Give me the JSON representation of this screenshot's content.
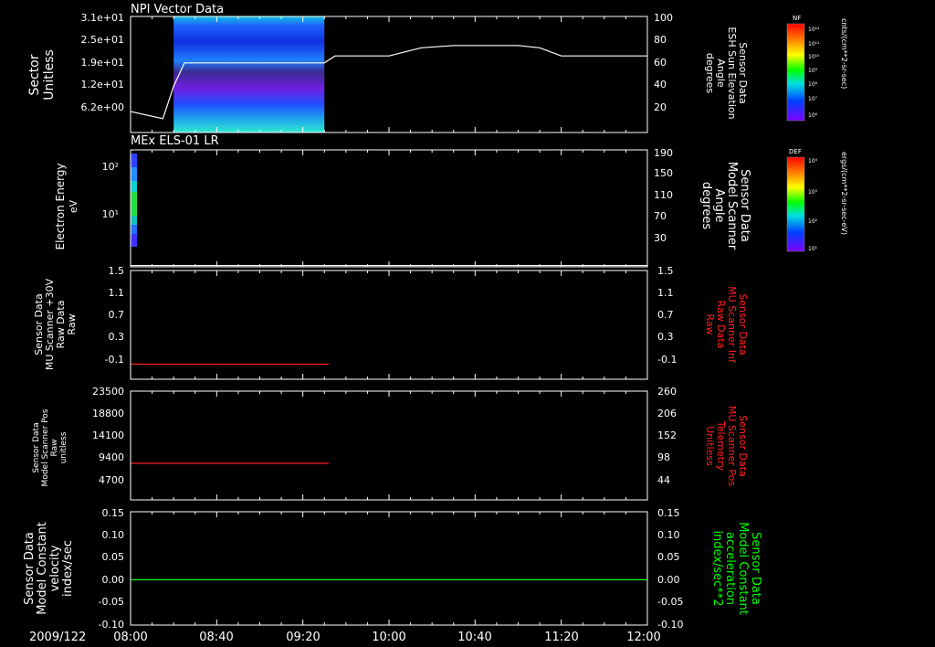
{
  "chart_data": [
    {
      "type": "heatmap",
      "title": "NPI Vector Data",
      "ylabel_left": [
        "Sector",
        "Unitless"
      ],
      "yticks_left": [
        "3.1e+01",
        "2.5e+01",
        "1.9e+01",
        "1.2e+01",
        "6.2e+00"
      ],
      "ylabel_right": [
        "Sensor Data",
        "ESH Sun Elevation",
        "Angle",
        "degrees"
      ],
      "yticks_right": [
        "100",
        "80",
        "60",
        "40",
        "20"
      ],
      "ylim_right": [
        0,
        100
      ],
      "spectrogram_time_range": [
        "08:20",
        "09:30"
      ],
      "overlay_line": {
        "color": "#ffffff",
        "x": [
          "08:00",
          "08:15",
          "08:20",
          "08:25",
          "09:30",
          "09:35",
          "09:45",
          "10:00",
          "10:15",
          "10:30",
          "11:00",
          "11:10",
          "11:20",
          "12:00"
        ],
        "y": [
          18,
          12,
          40,
          60,
          60,
          66,
          66,
          66,
          73,
          75,
          75,
          73,
          66,
          66
        ]
      },
      "colorbar": {
        "label": "NF",
        "units": "cnts/(cm**2-sr-sec)",
        "ticks": [
          "10¹²",
          "10¹¹",
          "10¹⁰",
          "10⁹",
          "10⁸",
          "10⁷",
          "10⁶"
        ]
      }
    },
    {
      "type": "heatmap",
      "title": "MEx ELS-01 LR",
      "ylabel_left": [
        "Electron Energy",
        "eV"
      ],
      "yticks_left": [
        "10²",
        "10¹"
      ],
      "ylabel_right": [
        "Sensor Data",
        "Model Scanner",
        "Angle",
        "degrees"
      ],
      "yticks_right": [
        "190",
        "150",
        "110",
        "70",
        "30"
      ],
      "ylim_right": [
        10,
        190
      ],
      "overlay_line": {
        "color": "#ffffff",
        "x": [
          "08:00",
          "12:00"
        ],
        "y": [
          12,
          12
        ]
      },
      "colorbar": {
        "label": "DEF",
        "units": "ergs/(cm**2-sr-sec-eV)",
        "ticks": [
          "10⁴",
          "10³",
          "10²",
          "10¹"
        ]
      }
    },
    {
      "type": "line",
      "ylabel_left": [
        "Sensor Data",
        "MU Scanner +30V",
        "Raw Data",
        "Raw"
      ],
      "yticks_left": [
        "1.5",
        "1.1",
        "0.7",
        "0.3",
        "-0.1"
      ],
      "ylim": [
        -0.3,
        1.5
      ],
      "ylabel_right": [
        "Sensor Data",
        "MU Scanner Inf",
        "Raw Data",
        "Raw"
      ],
      "yticks_right": [
        "1.5",
        "1.1",
        "0.7",
        "0.3",
        "-0.1"
      ],
      "series": [
        {
          "color": "#ff2020",
          "x": [
            "08:00",
            "09:32"
          ],
          "y": [
            -0.05,
            -0.05
          ]
        }
      ]
    },
    {
      "type": "line",
      "ylabel_left": [
        "Sensor Data",
        "Model Scanner Pos",
        "Raw",
        "unitless"
      ],
      "yticks_left": [
        "23500",
        "18800",
        "14100",
        "9400",
        "4700"
      ],
      "ylim": [
        0,
        23500
      ],
      "ylabel_right": [
        "Sensor Data",
        "MU Scanner Pos",
        "Telemetry",
        "Unitless"
      ],
      "yticks_right": [
        "260",
        "206",
        "152",
        "98",
        "44"
      ],
      "series": [
        {
          "color": "#ff2020",
          "x": [
            "08:00",
            "09:32"
          ],
          "y": [
            7900,
            7900
          ]
        }
      ]
    },
    {
      "type": "line",
      "ylabel_left": [
        "Sensor Data",
        "Model Constant",
        "velocity",
        "index/sec"
      ],
      "yticks_left": [
        "0.15",
        "0.10",
        "0.05",
        "0.00",
        "-0.05",
        "-0.10"
      ],
      "ylim": [
        -0.1,
        0.15
      ],
      "ylabel_right": [
        "Sensor Data",
        "Model Constant",
        "acceleration",
        "index/sec**2"
      ],
      "yticks_right": [
        "0.15",
        "0.10",
        "0.05",
        "0.00",
        "-0.05",
        "-0.10"
      ],
      "series": [
        {
          "color": "#00ff00",
          "x": [
            "08:00",
            "12:00"
          ],
          "y": [
            0.0,
            0.0
          ]
        }
      ]
    }
  ],
  "time_axis": {
    "date_label": "2009/122",
    "ticks": [
      "08:00",
      "08:40",
      "09:20",
      "10:00",
      "10:40",
      "11:20",
      "12:00"
    ],
    "range": [
      "08:00",
      "12:00"
    ]
  },
  "colors": {
    "axis": "#ffffff",
    "red_label": "#ff2020",
    "green_label": "#00ff00"
  }
}
